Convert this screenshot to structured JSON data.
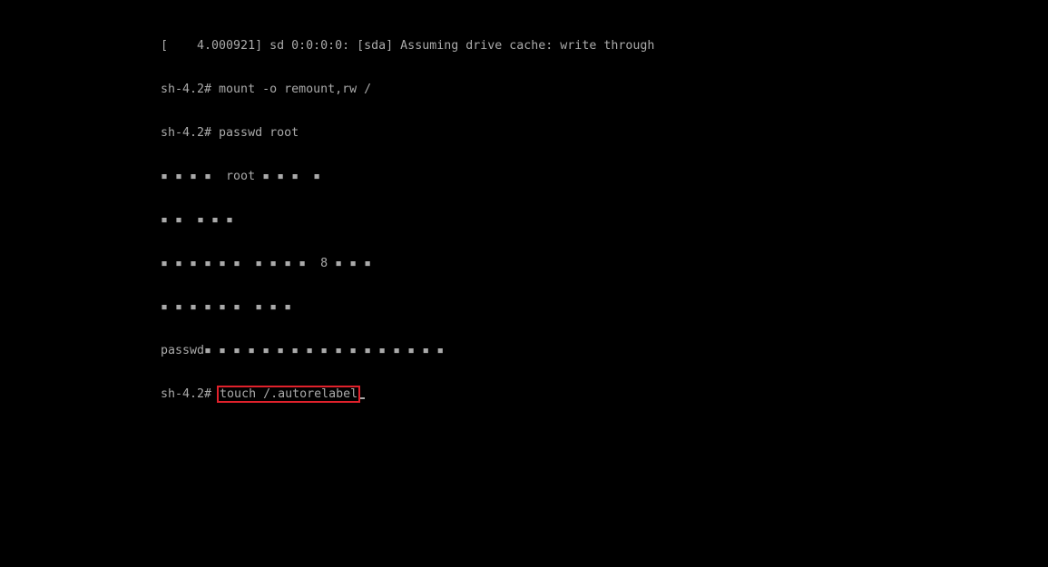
{
  "terminal": {
    "lines": [
      "[    4.000921] sd 0:0:0:0: [sda] Assuming drive cache: write through",
      "sh-4.2# mount -o remount,rw /",
      "sh-4.2# passwd root",
      "▪ ▪ ▪ ▪  root ▪ ▪ ▪  ▪",
      "▪ ▪  ▪ ▪ ▪",
      "▪ ▪ ▪ ▪ ▪ ▪  ▪ ▪ ▪ ▪  8 ▪ ▪ ▪",
      "▪ ▪ ▪ ▪ ▪ ▪  ▪ ▪ ▪",
      "passwd▪ ▪ ▪ ▪ ▪ ▪ ▪ ▪ ▪ ▪ ▪ ▪ ▪ ▪ ▪ ▪ ▪"
    ],
    "prompt": "sh-4.2# ",
    "current_command": "touch /.autorelabel",
    "highlight_color": "#e0212b"
  }
}
